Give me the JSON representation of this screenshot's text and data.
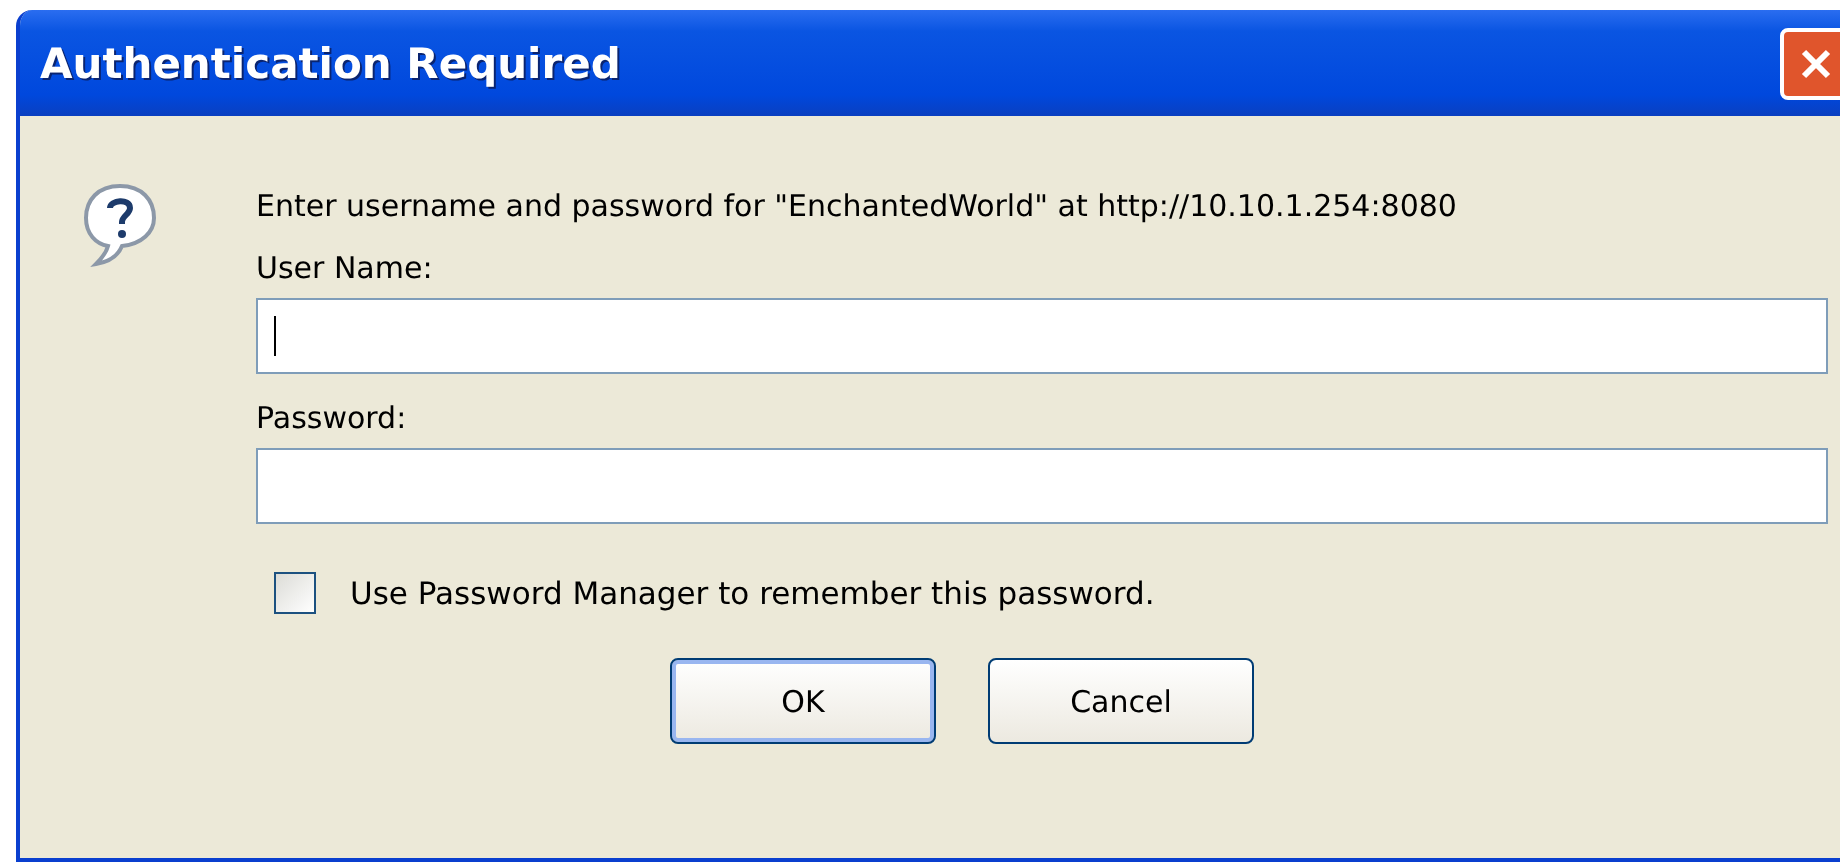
{
  "window": {
    "title": "Authentication Required"
  },
  "message": "Enter username and password for \"EnchantedWorld\" at http://10.10.1.254:8080",
  "fields": [
    {
      "label": "User Name:",
      "focused": true
    },
    {
      "label": "Password:",
      "focused": false
    }
  ],
  "remember": {
    "label": "Use Password Manager to remember this password.",
    "checked": false
  },
  "buttons": [
    {
      "label": "OK",
      "default": true
    },
    {
      "label": "Cancel",
      "default": false
    }
  ]
}
